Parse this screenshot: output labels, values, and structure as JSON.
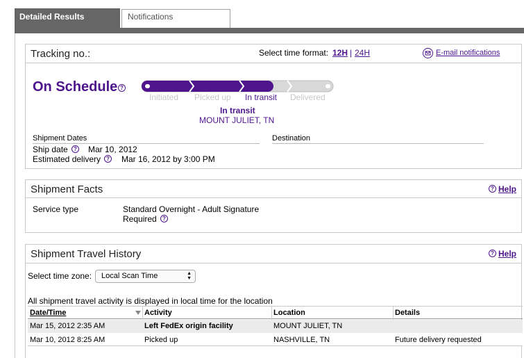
{
  "tabs": {
    "active": "Detailed Results",
    "inactive": "Notifications"
  },
  "tracking": {
    "label": "Tracking no.:",
    "time_format_label": "Select time format:",
    "fmt_12": "12H",
    "fmt_sep": "|",
    "fmt_24": "24H",
    "email_link": "E-mail notifications",
    "status": "On Schedule",
    "steps": [
      "Initiated",
      "Picked up",
      "In transit",
      "Delivered"
    ],
    "current_status": "In transit",
    "current_location": "MOUNT JULIET, TN",
    "shipment_dates_label": "Shipment Dates",
    "destination_label": "Destination",
    "ship_date_label": "Ship date",
    "ship_date_value": "Mar 10, 2012",
    "est_delivery_label": "Estimated delivery",
    "est_delivery_value": "Mar 16, 2012 by 3:00 PM"
  },
  "facts": {
    "title": "Shipment Facts",
    "help": "Help",
    "service_label": "Service type",
    "service_value": "Standard Overnight - Adult Signature",
    "service_value2": "Required"
  },
  "history": {
    "title": "Shipment Travel History",
    "help": "Help",
    "tz_label": "Select time zone:",
    "tz_value": "Local Scan Time",
    "note": "All shipment travel activity is displayed in local time for the location",
    "columns": [
      "Date/Time",
      "Activity",
      "Location",
      "Details"
    ],
    "rows": [
      [
        "Mar 15, 2012 2:35 AM",
        "Left FedEx origin facility",
        "MOUNT JULIET, TN",
        ""
      ],
      [
        "Mar 10, 2012 8:25 AM",
        "Picked up",
        "NASHVILLE, TN",
        "Future delivery requested"
      ]
    ]
  },
  "colors": {
    "brand_purple": "#4d148c",
    "tab_gray": "#666666",
    "border": "#c9c9c9",
    "row_alt": "#ebebeb"
  },
  "progress": {
    "completed_steps": 3,
    "total_steps": 4
  }
}
